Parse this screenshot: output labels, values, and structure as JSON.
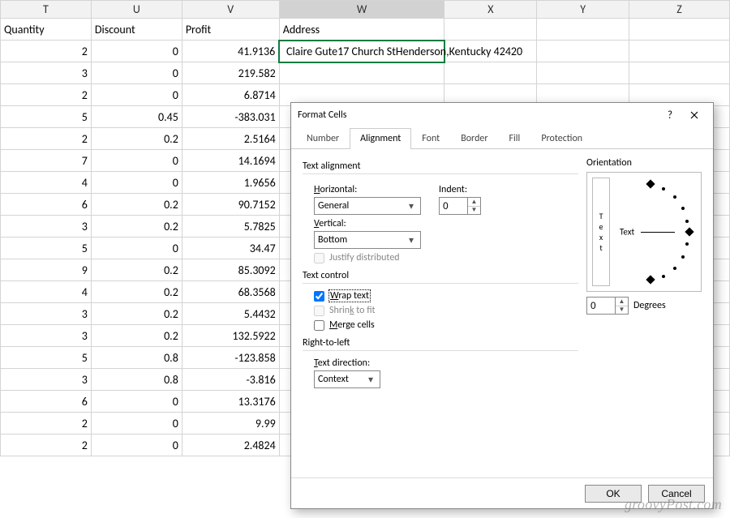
{
  "columns": [
    "T",
    "U",
    "V",
    "W",
    "X",
    "Y",
    "Z"
  ],
  "selected_col": "W",
  "headers": {
    "T": "Quantity",
    "U": "Discount",
    "V": "Profit",
    "W": "Address",
    "X": "",
    "Y": "",
    "Z": ""
  },
  "sel_row_text": "Claire Gute17 Church StHenderson,Kentucky 42420",
  "rows": [
    {
      "T": "2",
      "U": "0",
      "V": "41.9136",
      "W_included_in_overflow": true
    },
    {
      "T": "3",
      "U": "0",
      "V": "219.582"
    },
    {
      "T": "2",
      "U": "0",
      "V": "6.8714"
    },
    {
      "T": "5",
      "U": "0.45",
      "V": "-383.031"
    },
    {
      "T": "2",
      "U": "0.2",
      "V": "2.5164"
    },
    {
      "T": "7",
      "U": "0",
      "V": "14.1694"
    },
    {
      "T": "4",
      "U": "0",
      "V": "1.9656"
    },
    {
      "T": "6",
      "U": "0.2",
      "V": "90.7152"
    },
    {
      "T": "3",
      "U": "0.2",
      "V": "5.7825"
    },
    {
      "T": "5",
      "U": "0",
      "V": "34.47"
    },
    {
      "T": "9",
      "U": "0.2",
      "V": "85.3092"
    },
    {
      "T": "4",
      "U": "0.2",
      "V": "68.3568"
    },
    {
      "T": "3",
      "U": "0.2",
      "V": "5.4432"
    },
    {
      "T": "3",
      "U": "0.2",
      "V": "132.5922"
    },
    {
      "T": "5",
      "U": "0.8",
      "V": "-123.858"
    },
    {
      "T": "3",
      "U": "0.8",
      "V": "-3.816"
    },
    {
      "T": "6",
      "U": "0",
      "V": "13.3176"
    },
    {
      "T": "2",
      "U": "0",
      "V": "9.99"
    },
    {
      "T": "2",
      "U": "0",
      "V": "2.4824"
    }
  ],
  "dialog": {
    "title": "Format Cells",
    "tabs": [
      "Number",
      "Alignment",
      "Font",
      "Border",
      "Fill",
      "Protection"
    ],
    "active_tab": "Alignment",
    "text_alignment_label": "Text alignment",
    "horizontal_label": "Horizontal:",
    "horizontal_value": "General",
    "indent_label": "Indent:",
    "indent_value": "0",
    "vertical_label": "Vertical:",
    "vertical_value": "Bottom",
    "justify_label": "Justify distributed",
    "text_control_label": "Text control",
    "wrap_label": "Wrap text",
    "wrap_checked": true,
    "shrink_label": "Shrink to fit",
    "merge_label": "Merge cells",
    "rtl_label": "Right-to-left",
    "text_dir_label": "Text direction:",
    "text_dir_value": "Context",
    "orientation_label": "Orientation",
    "orient_vert_text": "Text",
    "orient_inner_text": "Text",
    "degrees_value": "0",
    "degrees_label": "Degrees",
    "ok": "OK",
    "cancel": "Cancel"
  },
  "watermark": "groovyPost.com"
}
